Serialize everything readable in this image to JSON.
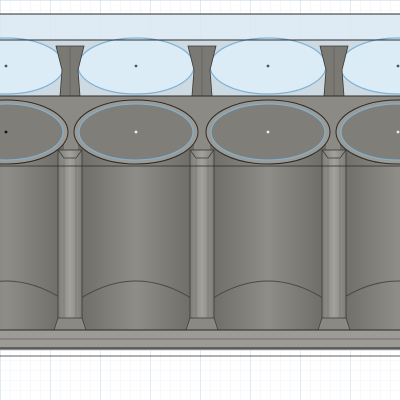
{
  "viewport": {
    "background": "#ffffff",
    "grid_minor_color": "#dfe9f4",
    "grid_major_color": "#c3d3e6"
  },
  "model": {
    "body_color": "#8b8a84",
    "body_light": "#a5a49e",
    "body_dark": "#5f5e5a",
    "edge_color": "#2b2b2b",
    "selection_color": "#7fb3d6",
    "ghost_fill": "#d6e8f6",
    "interior_color": "#4a4a46",
    "cells_front": 4,
    "cells_back": 4
  }
}
